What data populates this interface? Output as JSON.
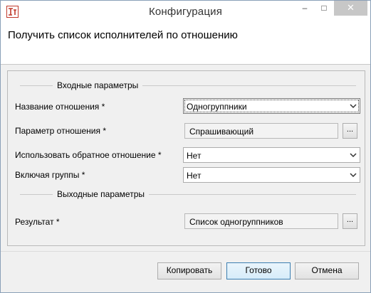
{
  "window": {
    "title": "Конфигурация",
    "minimize_glyph": "–",
    "maximize_glyph": "□",
    "close_glyph": "✕"
  },
  "header": {
    "title": "Получить список исполнителей по отношению"
  },
  "form": {
    "input_section_label": "Входные параметры",
    "output_section_label": "Выходные параметры",
    "fields": {
      "relation_name": {
        "label": "Название отношения *",
        "value": "Одногруппники"
      },
      "relation_param": {
        "label": "Параметр отношения *",
        "value": "Спрашивающий",
        "button": "..."
      },
      "reverse_relation": {
        "label": "Использовать обратное отношение *",
        "value": "Нет"
      },
      "include_groups": {
        "label": "Включая группы *",
        "value": "Нет"
      },
      "result": {
        "label": "Результат *",
        "value": "Список одногруппников",
        "button": "..."
      }
    }
  },
  "buttons": {
    "copy": "Копировать",
    "done": "Готово",
    "cancel": "Отмена"
  },
  "colors": {
    "accent": "#3c7fb1",
    "close_button": "#c7c7c7",
    "icon_red": "#c0392b"
  }
}
